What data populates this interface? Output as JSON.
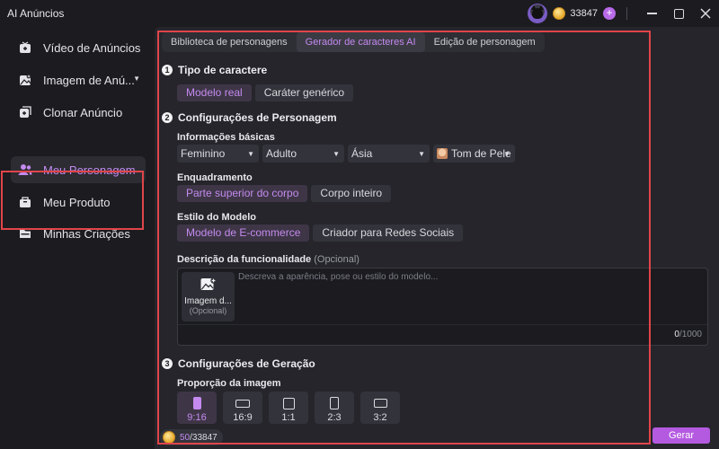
{
  "app": {
    "title": "AI Anúncios"
  },
  "header": {
    "credits": "33847",
    "plus": "+"
  },
  "sidebar": {
    "items": [
      {
        "label": "Vídeo de Anúncios"
      },
      {
        "label": "Imagem de Anú..."
      },
      {
        "label": "Clonar Anúncio"
      },
      {
        "label": "Meu Personagem"
      },
      {
        "label": "Meu Produto"
      },
      {
        "label": "Minhas Criações"
      }
    ]
  },
  "tabs": [
    {
      "label": "Biblioteca de personagens"
    },
    {
      "label": "Gerador de caracteres AI"
    },
    {
      "label": "Edição de personagem"
    }
  ],
  "section1": {
    "number": "1",
    "title": "Tipo de caractere",
    "options": [
      "Modelo real",
      "Caráter genérico"
    ],
    "selected": "Modelo real"
  },
  "section2": {
    "number": "2",
    "title": "Configurações de Personagem",
    "basic_label": "Informações básicas",
    "gender": "Feminino",
    "age": "Adulto",
    "region": "Ásia",
    "skin": "Tom de Pele",
    "framing_label": "Enquadramento",
    "framing_options": [
      "Parte superior do corpo",
      "Corpo inteiro"
    ],
    "style_label": "Estilo do Modelo",
    "style_options": [
      "Modelo de E-commerce",
      "Criador para Redes Sociais"
    ],
    "desc_label": "Descrição da funcionalidade",
    "desc_optional": "(Opcional)",
    "image_button": "Imagem d...",
    "image_optional": "(Opcional)",
    "placeholder": "Descreva a aparência, pose ou estilo do modelo...",
    "char_count": "0",
    "char_max": "/1000"
  },
  "section3": {
    "number": "3",
    "title": "Configurações de Geração",
    "ratio_label": "Proporção da imagem",
    "ratios": [
      "9:16",
      "16:9",
      "1:1",
      "2:3",
      "3:2"
    ],
    "selected": "9:16"
  },
  "footer": {
    "used": "50",
    "total": "/33847",
    "generate": "Gerar"
  }
}
